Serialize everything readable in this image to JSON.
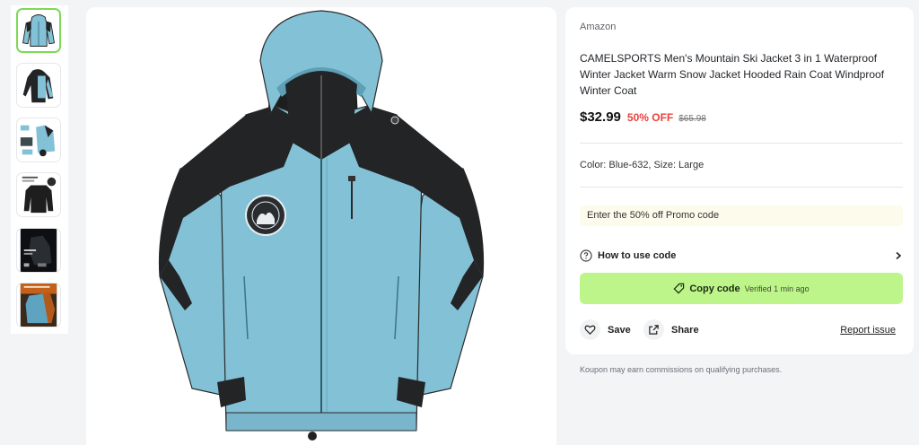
{
  "thumbnails": [
    {
      "name": "thumb-jacket-blue-front",
      "selected": true
    },
    {
      "name": "thumb-jacket-side",
      "selected": false
    },
    {
      "name": "thumb-jacket-parts",
      "selected": false
    },
    {
      "name": "thumb-jacket-black",
      "selected": false
    },
    {
      "name": "thumb-jacket-night",
      "selected": false
    },
    {
      "name": "thumb-jacket-lifestyle",
      "selected": false
    }
  ],
  "product": {
    "image_alt": "CAMELSPORTS blue and black 3 in 1 jacket",
    "store": "Amazon",
    "title": "CAMELSPORTS Men's Mountain Ski Jacket 3 in 1 Waterproof Winter Jacket Warm Snow Jacket Hooded Rain Coat Windproof Winter Coat",
    "price": "$32.99",
    "discount": "50% OFF",
    "original_price": "$65.98",
    "variant": "Color: Blue-632, Size: Large"
  },
  "promo": {
    "text": "Enter the 50% off Promo code",
    "how_to_label": "How to use code",
    "copy_label": "Copy code",
    "verified": "Verified 1 min ago"
  },
  "actions": {
    "save_label": "Save",
    "share_label": "Share",
    "report_label": "Report issue"
  },
  "disclaimer": "Koupon may earn commissions on qualifying purchases.",
  "colors": {
    "accent_green": "#bdf58a",
    "discount_red": "#e8423b",
    "jacket_blue": "#83c1d6",
    "jacket_black": "#232425"
  }
}
